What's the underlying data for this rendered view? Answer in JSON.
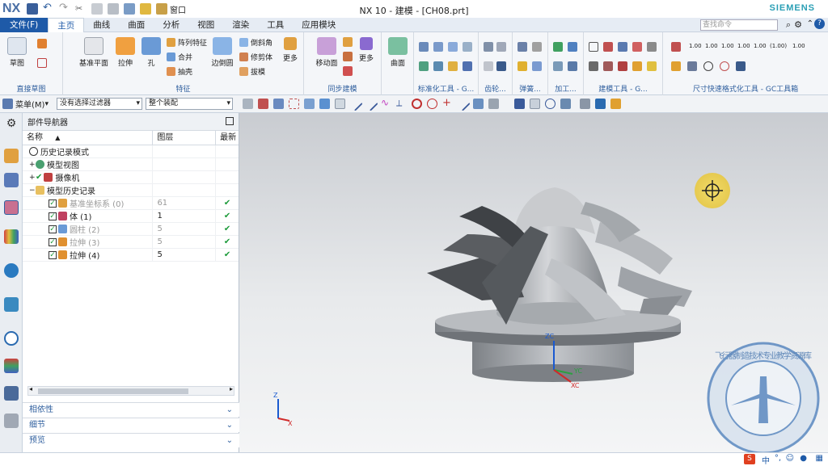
{
  "titlebar": {
    "logo": "NX",
    "window_menu": "窗口",
    "title": "NX 10 - 建模 - [CH08.prt]",
    "brand": "SIEMENS"
  },
  "menubar": {
    "file": "文件(F)",
    "tabs": [
      "主页",
      "曲线",
      "曲面",
      "分析",
      "视图",
      "渲染",
      "工具",
      "应用模块"
    ],
    "active_tab": "主页",
    "search_placeholder": "查找命令"
  },
  "ribbon": {
    "sketch": "草图",
    "direct_sketch_group": "直接草图",
    "datum_plane": "基准平面",
    "extrude": "拉伸",
    "hole": "孔",
    "pattern_feature": "阵列特征",
    "unite": "合并",
    "shell": "抽壳",
    "feature_group": "特征",
    "edge_blend": "边倒圆",
    "chamfer": "倒斜角",
    "trim_body": "修剪体",
    "draft": "拔模",
    "more1": "更多",
    "move_face": "移动面",
    "more2": "更多",
    "sync_group": "同步建模",
    "surface": "曲面",
    "standard_tools_group": "标准化工具 - G...",
    "gear_group": "齿轮...",
    "spring_group": "弹簧...",
    "machining_group": "加工...",
    "modeling_tools_group": "建模工具 - G...",
    "dimension_group": "尺寸快速格式化工具 - GC工具箱",
    "dim_labels": [
      "1.00",
      "1.00",
      "1.00",
      "1.00",
      "1.00",
      "(1.00)",
      "1.00"
    ]
  },
  "selection_bar": {
    "menu": "菜单(M)",
    "filter": "没有选择过滤器",
    "assembly": "整个装配"
  },
  "navigator": {
    "title": "部件导航器",
    "col_name": "名称",
    "col_layer": "图层",
    "col_latest": "最新",
    "rows": [
      {
        "name": "历史记录模式",
        "layer": "",
        "latest": "",
        "greyed": false
      },
      {
        "name": "模型视图",
        "layer": "",
        "latest": "",
        "greyed": false
      },
      {
        "name": "摄像机",
        "layer": "",
        "latest": "",
        "greyed": false
      },
      {
        "name": "模型历史记录",
        "layer": "",
        "latest": "",
        "greyed": false
      },
      {
        "name": "基准坐标系 (0)",
        "layer": "61",
        "latest": "✔",
        "greyed": true
      },
      {
        "name": "体 (1)",
        "layer": "1",
        "latest": "✔",
        "greyed": false
      },
      {
        "name": "圆柱 (2)",
        "layer": "5",
        "latest": "✔",
        "greyed": true
      },
      {
        "name": "拉伸 (3)",
        "layer": "5",
        "latest": "✔",
        "greyed": true
      },
      {
        "name": "拉伸 (4)",
        "layer": "5",
        "latest": "✔",
        "greyed": false
      }
    ],
    "sections": [
      "相依性",
      "细节",
      "预览"
    ]
  },
  "viewport": {
    "axis_z": "ZC",
    "axis_y": "YC",
    "axis_x": "XC",
    "tri_z": "Z",
    "tri_x": "X",
    "watermark_text": "飞行器制造技术专业教学资源库"
  },
  "statusbar": {
    "ime": "中"
  },
  "colors": {
    "accent": "#1e5aa8",
    "brand": "#2a9fb5",
    "check": "#1c9a3a"
  }
}
